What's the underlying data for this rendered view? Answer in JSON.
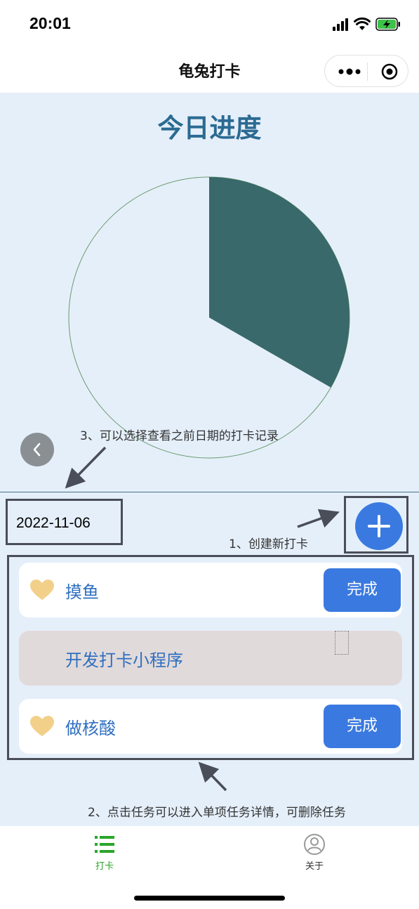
{
  "status_bar": {
    "time": "20:01"
  },
  "nav": {
    "title": "龟兔打卡"
  },
  "page": {
    "title": "今日进度"
  },
  "colors": {
    "progress_done": "#39696a",
    "progress_remaining": "#e5effa",
    "accent_blue": "#3a7ae0",
    "heart": "#f2d08a",
    "tab_active": "#2aa52a",
    "tab_inactive": "#999999"
  },
  "progress": {
    "completed_fraction": 0.333
  },
  "annotations": {
    "history": "3、可以选择查看之前日期的打卡记录",
    "create": "1、创建新打卡",
    "detail": "2、点击任务可以进入单项任务详情，可删除任务"
  },
  "date": {
    "value": "2022-11-06"
  },
  "tasks": [
    {
      "name": "摸鱼",
      "button": "完成",
      "completed": false
    },
    {
      "name": "开发打卡小程序",
      "completed": true
    },
    {
      "name": "做核酸",
      "button": "完成",
      "completed": false
    }
  ],
  "tab_bar": {
    "items": [
      {
        "label": "打卡",
        "icon": "list-icon",
        "active": true
      },
      {
        "label": "关于",
        "icon": "user-icon",
        "active": false
      }
    ]
  }
}
